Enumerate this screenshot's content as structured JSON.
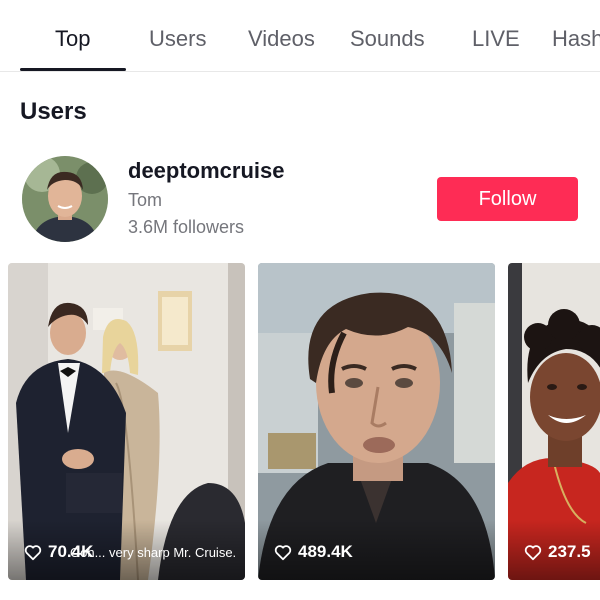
{
  "tabs": [
    {
      "label": "Top"
    },
    {
      "label": "Users"
    },
    {
      "label": "Videos"
    },
    {
      "label": "Sounds"
    },
    {
      "label": "LIVE"
    },
    {
      "label": "Hash"
    }
  ],
  "section": {
    "title": "Users"
  },
  "user": {
    "username": "deeptomcruise",
    "nickname": "Tom",
    "followers": "3.6M followers",
    "follow_label": "Follow"
  },
  "videos": [
    {
      "likes": "70.4K",
      "caption": "Ooh... very sharp Mr. Cruise."
    },
    {
      "likes": "489.4K",
      "caption": ""
    },
    {
      "likes": "237.5",
      "caption": ""
    }
  ],
  "colors": {
    "follow": "#fe2c55",
    "text": "#161823",
    "muted": "#75767c"
  }
}
